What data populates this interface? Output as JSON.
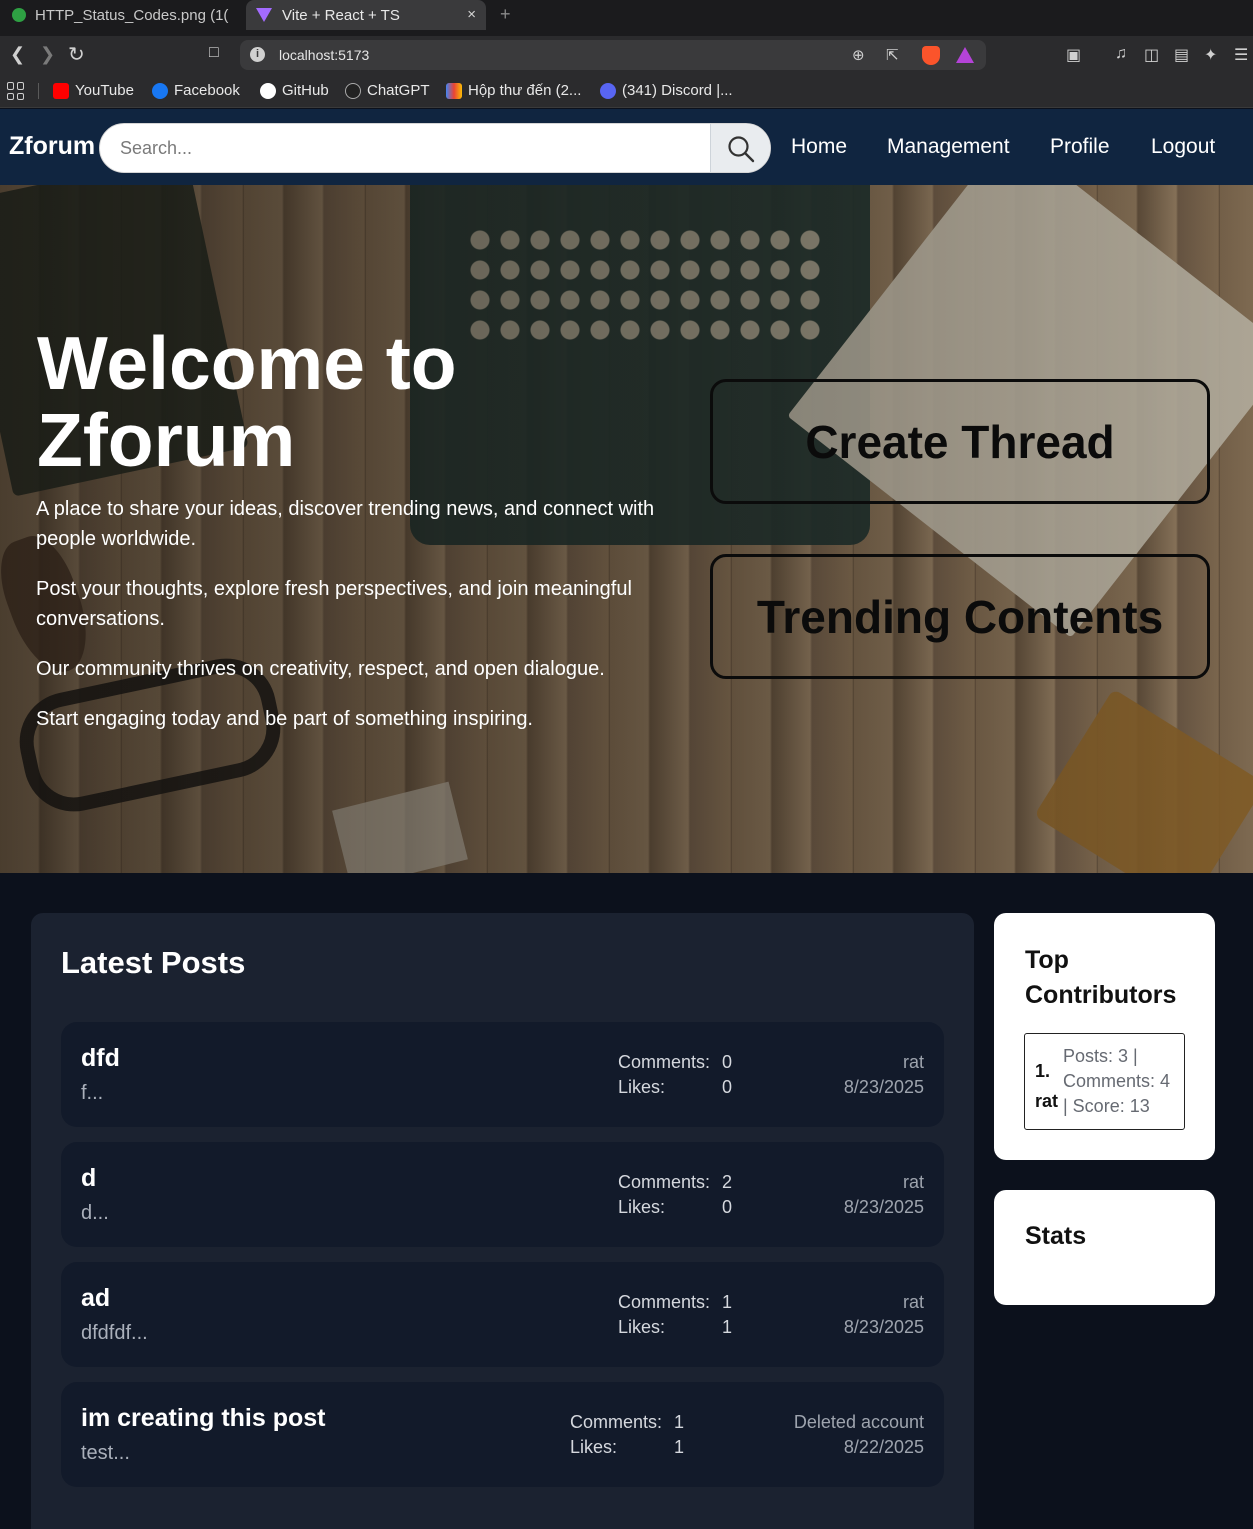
{
  "browser": {
    "tabs": [
      {
        "label": "HTTP_Status_Codes.png (1("
      },
      {
        "label": "Vite + React + TS",
        "close": "×"
      }
    ],
    "new_tab": "+",
    "url": "localhost:5173",
    "bookmarks": [
      {
        "label": "YouTube",
        "color": "#ff0000"
      },
      {
        "label": "Facebook",
        "color": "#1877f2"
      },
      {
        "label": "GitHub",
        "color": "#ffffff"
      },
      {
        "label": "ChatGPT",
        "color": "#222222"
      },
      {
        "label": "Hộp thư đến (2...",
        "color": "#ea4335"
      },
      {
        "label": "(341) Discord |...",
        "color": "#5865f2"
      }
    ]
  },
  "header": {
    "logo": "Zforum",
    "search_placeholder": "Search...",
    "nav": [
      "Home",
      "Management",
      "Profile",
      "Logout"
    ]
  },
  "hero": {
    "title": "Welcome to Zforum",
    "paragraphs": [
      "A place to share your ideas, discover trending news, and connect with people worldwide.",
      "Post your thoughts, explore fresh perspectives, and join meaningful conversations.",
      "Our community thrives on creativity, respect, and open dialogue.",
      "Start engaging today and be part of something inspiring."
    ],
    "buttons": [
      "Create Thread",
      "Trending Contents"
    ]
  },
  "latest": {
    "title": "Latest Posts",
    "comments_label": "Comments:",
    "likes_label": "Likes:",
    "posts": [
      {
        "title": "dfd",
        "excerpt": "f...",
        "comments": "0",
        "likes": "0",
        "author": "rat",
        "date": "8/23/2025"
      },
      {
        "title": "d",
        "excerpt": "d...",
        "comments": "2",
        "likes": "0",
        "author": "rat",
        "date": "8/23/2025"
      },
      {
        "title": "ad",
        "excerpt": "dfdfdf...",
        "comments": "1",
        "likes": "1",
        "author": "rat",
        "date": "8/23/2025"
      },
      {
        "title": "im creating this post",
        "excerpt": "test...",
        "comments": "1",
        "likes": "1",
        "author": "Deleted account",
        "date": "8/22/2025"
      }
    ]
  },
  "sidebar": {
    "top_contributors_title": "Top Contributors",
    "contributors": [
      {
        "rank": "1.",
        "name": "rat",
        "posts": "Posts: 3 |",
        "comments": "Comments: 4",
        "score": "| Score: 13"
      }
    ],
    "stats_title": "Stats"
  }
}
